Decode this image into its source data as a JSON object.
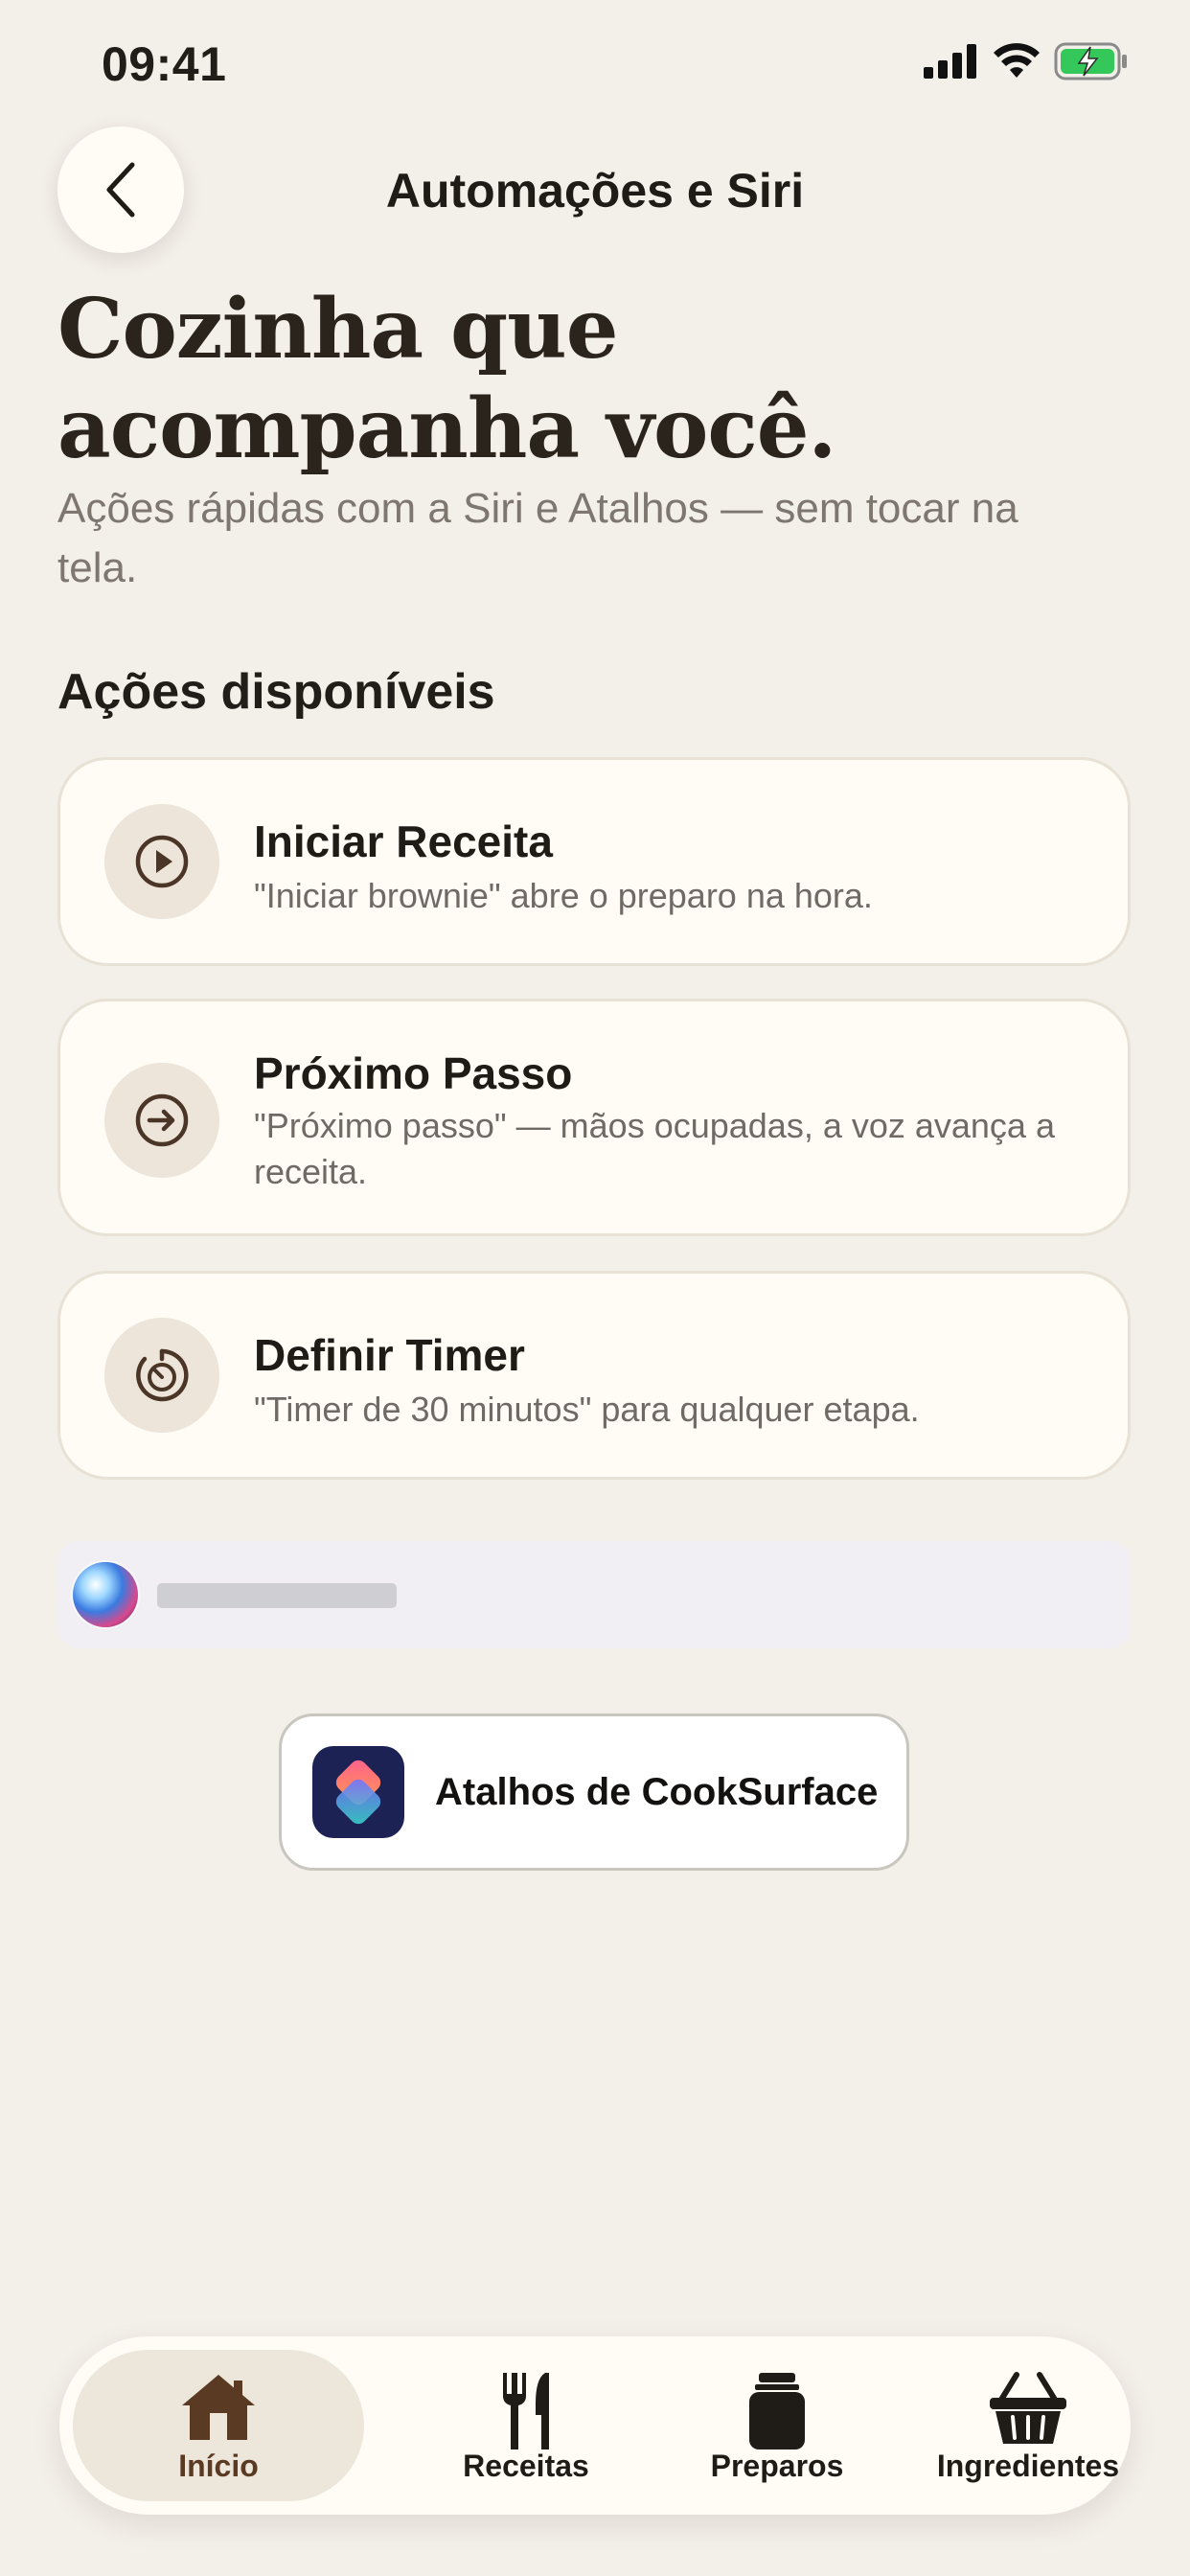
{
  "status_bar": {
    "time": "09:41"
  },
  "header": {
    "title": "Automações e Siri"
  },
  "hero": {
    "title_line1": "Cozinha que",
    "title_line2": "acompanha você.",
    "subtitle": "Ações rápidas com a Siri e Atalhos — sem tocar na tela."
  },
  "section": {
    "title": "Ações disponíveis"
  },
  "actions": [
    {
      "title": "Iniciar Receita",
      "description": "\"Iniciar brownie\" abre o preparo na hora.",
      "icon": "play-icon"
    },
    {
      "title": "Próximo Passo",
      "description": "\"Próximo passo\" — mãos ocupadas, a voz avança a receita.",
      "icon": "arrow-right-circle-icon"
    },
    {
      "title": "Definir Timer",
      "description": "\"Timer de 30 minutos\" para qualquer etapa.",
      "icon": "timer-icon"
    }
  ],
  "shortcuts_button": {
    "label": "Atalhos de CookSurface",
    "icon": "shortcuts-app-icon"
  },
  "tabs": [
    {
      "label": "Início",
      "icon": "home-icon",
      "active": true
    },
    {
      "label": "Receitas",
      "icon": "fork-knife-icon",
      "active": false
    },
    {
      "label": "Preparos",
      "icon": "jar-icon",
      "active": false
    },
    {
      "label": "Ingredientes",
      "icon": "basket-icon",
      "active": false
    }
  ],
  "colors": {
    "background": "#f3efe9",
    "card": "#fffcf6",
    "accent_brown": "#5a3a22",
    "battery_green": "#34c759"
  }
}
